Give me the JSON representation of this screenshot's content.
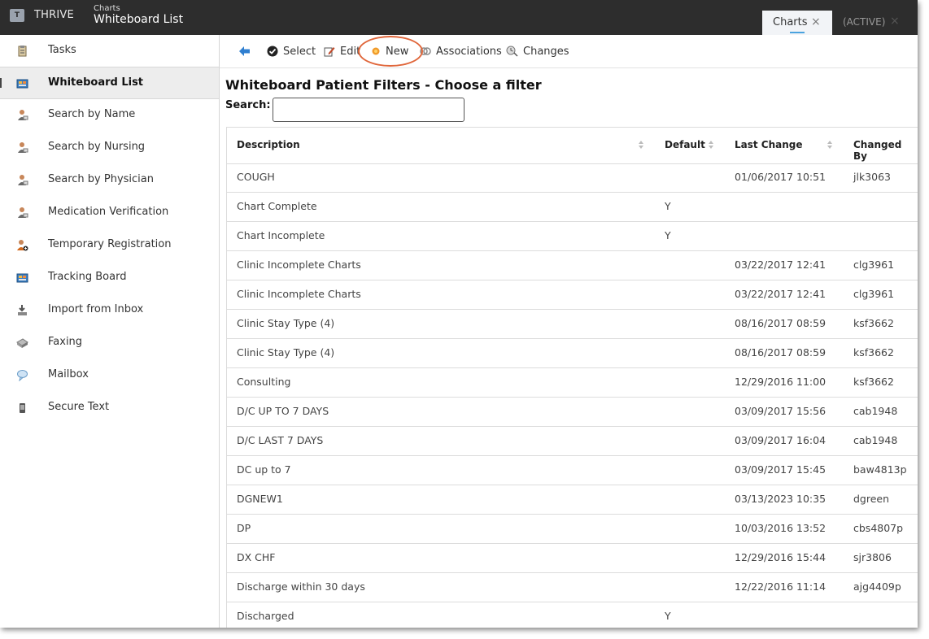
{
  "app": {
    "brand": "THRIVE",
    "breadcrumb_top": "Charts",
    "breadcrumb_title": "Whiteboard List",
    "tabs": [
      {
        "label": "Charts",
        "close": "×"
      },
      {
        "label": "(ACTIVE)",
        "close": "×"
      }
    ]
  },
  "sidebar": {
    "items": [
      {
        "label": "Tasks",
        "icon": "clipboard-icon"
      },
      {
        "label": "Whiteboard List",
        "icon": "whiteboard-icon"
      },
      {
        "label": "Search by Name",
        "icon": "person-search-icon"
      },
      {
        "label": "Search by Nursing",
        "icon": "person-search-icon"
      },
      {
        "label": "Search by Physician",
        "icon": "person-search-icon"
      },
      {
        "label": "Medication Verification",
        "icon": "person-search-icon"
      },
      {
        "label": "Temporary Registration",
        "icon": "person-add-icon"
      },
      {
        "label": "Tracking Board",
        "icon": "whiteboard-icon"
      },
      {
        "label": "Import from Inbox",
        "icon": "import-icon"
      },
      {
        "label": "Faxing",
        "icon": "fax-icon"
      },
      {
        "label": "Mailbox",
        "icon": "mailbox-icon"
      },
      {
        "label": "Secure Text",
        "icon": "phone-icon"
      }
    ]
  },
  "toolbar": {
    "select": "Select",
    "edit": "Edit",
    "new": "New",
    "associations": "Associations",
    "changes": "Changes"
  },
  "main": {
    "title": "Whiteboard Patient Filters - Choose a filter",
    "search_label": "Search:",
    "search_value": ""
  },
  "table": {
    "columns": [
      "Description",
      "Default",
      "Last Change",
      "Changed By"
    ],
    "rows": [
      [
        "COUGH",
        "",
        "01/06/2017 10:51",
        "jlk3063"
      ],
      [
        "Chart Complete",
        "Y",
        "",
        ""
      ],
      [
        "Chart Incomplete",
        "Y",
        "",
        ""
      ],
      [
        "Clinic Incomplete Charts",
        "",
        "03/22/2017 12:41",
        "clg3961"
      ],
      [
        "Clinic Incomplete Charts",
        "",
        "03/22/2017 12:41",
        "clg3961"
      ],
      [
        "Clinic Stay Type (4)",
        "",
        "08/16/2017 08:59",
        "ksf3662"
      ],
      [
        "Clinic Stay Type (4)",
        "",
        "08/16/2017 08:59",
        "ksf3662"
      ],
      [
        "Consulting",
        "",
        "12/29/2016 11:00",
        "ksf3662"
      ],
      [
        "D/C UP TO 7 DAYS",
        "",
        "03/09/2017 15:56",
        "cab1948"
      ],
      [
        "D/C LAST 7 DAYS",
        "",
        "03/09/2017 16:04",
        "cab1948"
      ],
      [
        "DC up to 7",
        "",
        "03/09/2017 15:45",
        "baw4813p"
      ],
      [
        "DGNEW1",
        "",
        "03/13/2023 10:35",
        "dgreen"
      ],
      [
        "DP",
        "",
        "10/03/2016 13:52",
        "cbs4807p"
      ],
      [
        "DX CHF",
        "",
        "12/29/2016 15:44",
        "sjr3806"
      ],
      [
        "Discharge within 30 days",
        "",
        "12/22/2016 11:14",
        "ajg4409p"
      ],
      [
        "Discharged",
        "Y",
        "",
        ""
      ]
    ]
  },
  "colors": {
    "topbar": "#2d2d2d",
    "highlight_circle": "#e0663a",
    "tab_underline": "#4aa3df"
  }
}
